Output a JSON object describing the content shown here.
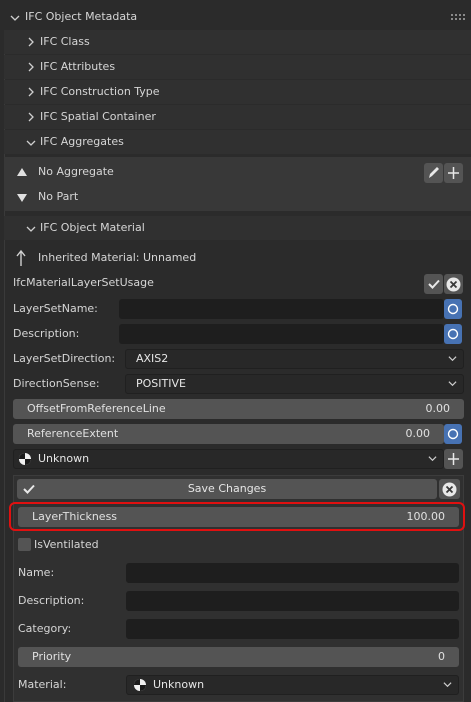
{
  "header": {
    "title": "IFC Object Metadata"
  },
  "subsections": [
    {
      "label": "IFC Class"
    },
    {
      "label": "IFC Attributes"
    },
    {
      "label": "IFC Construction Type"
    },
    {
      "label": "IFC Spatial Container"
    },
    {
      "label": "IFC Aggregates"
    }
  ],
  "aggregates": {
    "no_aggregate": "No Aggregate",
    "no_part": "No Part"
  },
  "material_section": {
    "title": "IFC Object Material",
    "inherited": "Inherited Material: Unnamed",
    "usage_label": "IfcMaterialLayerSetUsage",
    "layer_set_name_label": "LayerSetName:",
    "layer_set_name_value": "",
    "description_label": "Description:",
    "description_value": "",
    "direction_label": "LayerSetDirection:",
    "direction_value": "AXIS2",
    "sense_label": "DirectionSense:",
    "sense_value": "POSITIVE",
    "offset_label": "OffsetFromReferenceLine",
    "offset_value": "0.00",
    "extent_label": "ReferenceExtent",
    "extent_value": "0.00",
    "material_select": "Unknown"
  },
  "layer_editor": {
    "save_label": "Save Changes",
    "thickness_label": "LayerThickness",
    "thickness_value": "100.00",
    "ventilated_label": "IsVentilated",
    "ventilated_checked": false,
    "name_label": "Name:",
    "name_value": "",
    "description_label": "Description:",
    "description_value": "",
    "category_label": "Category:",
    "category_value": "",
    "priority_label": "Priority",
    "priority_value": "0",
    "material_label": "Material:",
    "material_value": "Unknown"
  },
  "colors": {
    "accent_blue": "#4772b3",
    "highlight_red": "#e01010",
    "panel_bg": "#2b2b2b",
    "subpanel_bg": "#303030"
  }
}
